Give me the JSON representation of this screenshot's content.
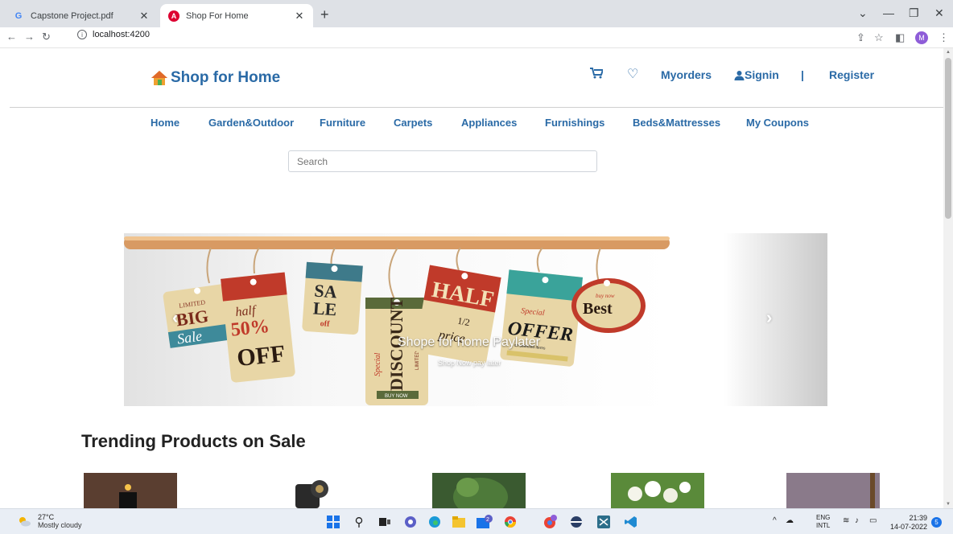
{
  "browser": {
    "tabs": [
      {
        "title": "Capstone Project.pdf",
        "icon": "google-docs-icon"
      },
      {
        "title": "Shop For Home",
        "icon": "angular-icon",
        "active": true
      }
    ],
    "new_tab": "+",
    "address": "localhost:4200",
    "profile_initial": "M"
  },
  "header": {
    "brand": "Shop for Home",
    "nav": {
      "orders": "Myorders",
      "signin": "Signin",
      "separator": "|",
      "register": "Register"
    }
  },
  "categories": [
    "Home",
    "Garden&Outdoor",
    "Furniture",
    "Carpets",
    "Appliances",
    "Furnishings",
    "Beds&Mattresses",
    "My Coupons"
  ],
  "search": {
    "placeholder": "Search"
  },
  "carousel": {
    "caption": "Shope for home Paylater",
    "subcaption": "Shop Now pay later",
    "tag_texts": {
      "limited": "LIMITED",
      "big": "BIG",
      "sale": "Sale",
      "half": "half",
      "percent": "50%",
      "off": "OFF",
      "sa": "SA",
      "le": "LE",
      "off_small": "off",
      "special": "Special",
      "discount": "DISCOUNT",
      "limited_v": "LIMITED",
      "buy_now": "BUY NOW",
      "half_big": "HALF",
      "one_half": "1/2",
      "price": "price",
      "special_offer": "Special",
      "offer": "OFFER",
      "on_selected": "on selected items",
      "buy_now_small": "buy now",
      "best": "Best"
    }
  },
  "trending": {
    "title": "Trending Products on Sale"
  },
  "taskbar": {
    "weather_temp": "27°C",
    "weather_desc": "Mostly cloudy",
    "lang_1": "ENG",
    "lang_2": "INTL",
    "time": "21:39",
    "date": "14-07-2022",
    "notifications": "5",
    "badge_count": "2"
  },
  "colors": {
    "brand_blue": "#2a6aa6",
    "tab_bar": "#dee1e6",
    "taskbar": "#e9eef5"
  }
}
